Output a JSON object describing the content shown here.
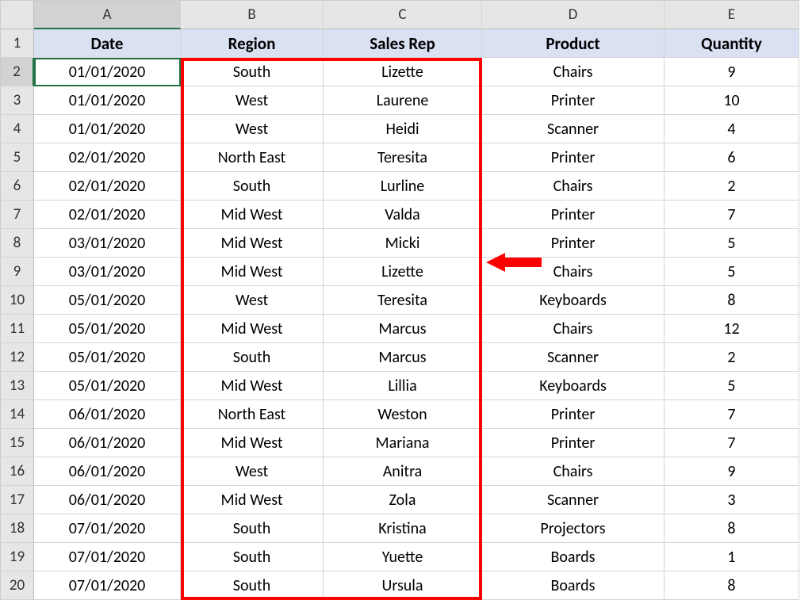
{
  "columns": [
    "A",
    "B",
    "C",
    "D",
    "E"
  ],
  "row_numbers": [
    1,
    2,
    3,
    4,
    5,
    6,
    7,
    8,
    9,
    10,
    11,
    12,
    13,
    14,
    15,
    16,
    17,
    18,
    19,
    20
  ],
  "active_cell": "A2",
  "headers": [
    "Date",
    "Region",
    "Sales Rep",
    "Product",
    "Quantity"
  ],
  "rows": [
    {
      "date": "01/01/2020",
      "region": "South",
      "rep": "Lizette",
      "product": "Chairs",
      "qty": "9"
    },
    {
      "date": "01/01/2020",
      "region": "West",
      "rep": "Laurene",
      "product": "Printer",
      "qty": "10"
    },
    {
      "date": "01/01/2020",
      "region": "West",
      "rep": "Heidi",
      "product": "Scanner",
      "qty": "4"
    },
    {
      "date": "02/01/2020",
      "region": "North East",
      "rep": "Teresita",
      "product": "Printer",
      "qty": "6"
    },
    {
      "date": "02/01/2020",
      "region": "South",
      "rep": "Lurline",
      "product": "Chairs",
      "qty": "2"
    },
    {
      "date": "02/01/2020",
      "region": "Mid West",
      "rep": "Valda",
      "product": "Printer",
      "qty": "7"
    },
    {
      "date": "03/01/2020",
      "region": "Mid West",
      "rep": "Micki",
      "product": "Printer",
      "qty": "5"
    },
    {
      "date": "03/01/2020",
      "region": "Mid West",
      "rep": "Lizette",
      "product": "Chairs",
      "qty": "5"
    },
    {
      "date": "05/01/2020",
      "region": "West",
      "rep": "Teresita",
      "product": "Keyboards",
      "qty": "8"
    },
    {
      "date": "05/01/2020",
      "region": "Mid West",
      "rep": "Marcus",
      "product": "Chairs",
      "qty": "12"
    },
    {
      "date": "05/01/2020",
      "region": "South",
      "rep": "Marcus",
      "product": "Scanner",
      "qty": "2"
    },
    {
      "date": "05/01/2020",
      "region": "Mid West",
      "rep": "Lillia",
      "product": "Keyboards",
      "qty": "5"
    },
    {
      "date": "06/01/2020",
      "region": "North East",
      "rep": "Weston",
      "product": "Printer",
      "qty": "7"
    },
    {
      "date": "06/01/2020",
      "region": "Mid West",
      "rep": "Mariana",
      "product": "Printer",
      "qty": "7"
    },
    {
      "date": "06/01/2020",
      "region": "West",
      "rep": "Anitra",
      "product": "Chairs",
      "qty": "9"
    },
    {
      "date": "06/01/2020",
      "region": "Mid West",
      "rep": "Zola",
      "product": "Scanner",
      "qty": "3"
    },
    {
      "date": "07/01/2020",
      "region": "South",
      "rep": "Kristina",
      "product": "Projectors",
      "qty": "8"
    },
    {
      "date": "07/01/2020",
      "region": "South",
      "rep": "Yuette",
      "product": "Boards",
      "qty": "1"
    },
    {
      "date": "07/01/2020",
      "region": "South",
      "rep": "Ursula",
      "product": "Boards",
      "qty": "8"
    }
  ],
  "annotation": {
    "highlight_range": "B2:C20",
    "arrow_target_row": 9,
    "arrow_color": "#ff0000"
  }
}
